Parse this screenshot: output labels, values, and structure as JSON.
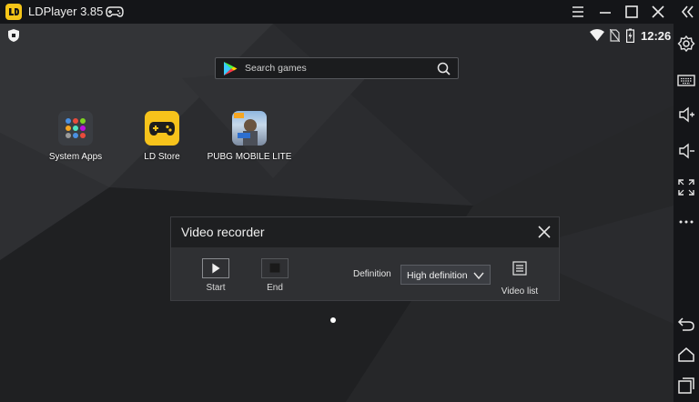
{
  "titlebar": {
    "title": "LDPlayer 3.85",
    "icons": [
      "ldplayer-logo",
      "gamepad-icon",
      "menu-icon",
      "minimize-icon",
      "maximize-icon",
      "close-icon",
      "collapse-sidebar-icon"
    ]
  },
  "statusbar": {
    "time": "12:26",
    "icons": [
      "shield-icon",
      "wifi-icon",
      "no-sim-icon",
      "battery-icon"
    ]
  },
  "search": {
    "placeholder": "Search games"
  },
  "apps": [
    {
      "label": "System Apps",
      "icon": "system-apps-folder-icon"
    },
    {
      "label": "LD Store",
      "icon": "ld-store-icon"
    },
    {
      "label": "PUBG MOBILE LITE",
      "icon": "pubg-mobile-lite-icon"
    }
  ],
  "recorder": {
    "title": "Video recorder",
    "start_label": "Start",
    "end_label": "End",
    "definition_label": "Definition",
    "definition_value": "High definition",
    "video_list_label": "Video list"
  },
  "sidebar": {
    "icons": [
      "settings-icon",
      "keyboard-icon",
      "volume-up-icon",
      "volume-down-icon",
      "fullscreen-icon",
      "more-icon",
      "back-icon",
      "home-icon",
      "recents-icon"
    ]
  },
  "colors": {
    "titlebar_bg": "#141518",
    "ld_store_yellow": "#f7c31b",
    "dialog_bg": "#2f3033"
  }
}
